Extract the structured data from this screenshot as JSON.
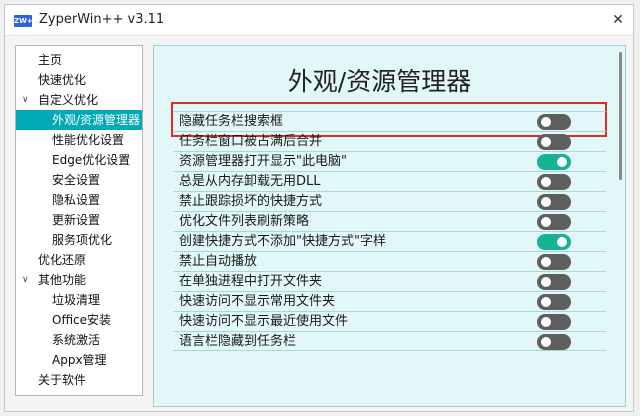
{
  "window": {
    "title": "ZyperWin++ v3.11",
    "icon_text": "ZW++",
    "close_glyph": "✕"
  },
  "sidebar": {
    "items": [
      {
        "label": "主页",
        "level": 0,
        "expanded": null,
        "selected": false
      },
      {
        "label": "快速优化",
        "level": 0,
        "expanded": null,
        "selected": false
      },
      {
        "label": "自定义优化",
        "level": 0,
        "expanded": true,
        "selected": false
      },
      {
        "label": "外观/资源管理器",
        "level": 1,
        "expanded": null,
        "selected": true
      },
      {
        "label": "性能优化设置",
        "level": 1,
        "expanded": null,
        "selected": false
      },
      {
        "label": "Edge优化设置",
        "level": 1,
        "expanded": null,
        "selected": false
      },
      {
        "label": "安全设置",
        "level": 1,
        "expanded": null,
        "selected": false
      },
      {
        "label": "隐私设置",
        "level": 1,
        "expanded": null,
        "selected": false
      },
      {
        "label": "更新设置",
        "level": 1,
        "expanded": null,
        "selected": false
      },
      {
        "label": "服务项优化",
        "level": 1,
        "expanded": null,
        "selected": false
      },
      {
        "label": "优化还原",
        "level": 0,
        "expanded": null,
        "selected": false
      },
      {
        "label": "其他功能",
        "level": 0,
        "expanded": true,
        "selected": false
      },
      {
        "label": "垃圾清理",
        "level": 1,
        "expanded": null,
        "selected": false
      },
      {
        "label": "Office安装",
        "level": 1,
        "expanded": null,
        "selected": false
      },
      {
        "label": "系统激活",
        "level": 1,
        "expanded": null,
        "selected": false
      },
      {
        "label": "Appx管理",
        "level": 1,
        "expanded": null,
        "selected": false
      },
      {
        "label": "关于软件",
        "level": 0,
        "expanded": null,
        "selected": false
      }
    ],
    "caret_glyph": "∨"
  },
  "main": {
    "title": "外观/资源管理器",
    "settings": [
      {
        "label": "隐藏任务栏搜索框",
        "on": false
      },
      {
        "label": "任务栏窗口被占满后合并",
        "on": false
      },
      {
        "label": "资源管理器打开显示\"此电脑\"",
        "on": true
      },
      {
        "label": "总是从内存卸载无用DLL",
        "on": false
      },
      {
        "label": "禁止跟踪损坏的快捷方式",
        "on": false
      },
      {
        "label": "优化文件列表刷新策略",
        "on": false
      },
      {
        "label": "创建快捷方式不添加\"快捷方式\"字样",
        "on": true
      },
      {
        "label": "禁止自动播放",
        "on": false
      },
      {
        "label": "在单独进程中打开文件夹",
        "on": false
      },
      {
        "label": "快速访问不显示常用文件夹",
        "on": false
      },
      {
        "label": "快速访问不显示最近使用文件",
        "on": false
      },
      {
        "label": "语言栏隐藏到任务栏",
        "on": false
      }
    ]
  },
  "colors": {
    "accent": "#00a8b8",
    "toggle_on": "#17b396",
    "toggle_off": "#5f5f5f",
    "highlight": "#e22a2a",
    "panel_bg": "#e2f7f7"
  }
}
